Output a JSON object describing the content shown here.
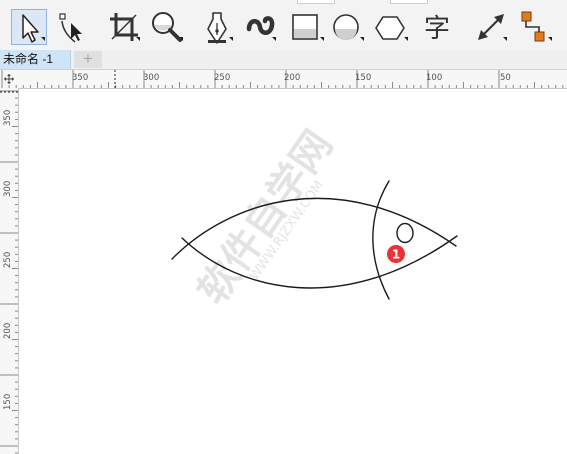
{
  "toolbar": {
    "tools": [
      {
        "name": "pick-tool",
        "icon": "arrow-pointer-icon",
        "selected": true
      },
      {
        "name": "shape-tool",
        "icon": "shape-edit-icon"
      },
      {
        "name": "crop-tool",
        "icon": "crop-icon"
      },
      {
        "name": "zoom-tool",
        "icon": "magnifier-icon"
      },
      {
        "name": "pen-tool",
        "icon": "pen-nib-icon"
      },
      {
        "name": "artistic-media-tool",
        "icon": "artistic-media-icon"
      },
      {
        "name": "rectangle-tool",
        "icon": "rectangle-icon"
      },
      {
        "name": "ellipse-tool",
        "icon": "ellipse-icon"
      },
      {
        "name": "polygon-tool",
        "icon": "hexagon-icon"
      },
      {
        "name": "text-tool",
        "icon": "text-icon",
        "label": "字"
      },
      {
        "name": "dimension-tool",
        "icon": "dimension-arrow-icon"
      },
      {
        "name": "connector-tool",
        "icon": "connector-icon"
      }
    ]
  },
  "tabs": {
    "document_title": "未命名 -1",
    "add_tab_symbol": "+"
  },
  "ruler": {
    "horizontal_labels": [
      "350",
      "300",
      "250",
      "200",
      "150",
      "100",
      "50"
    ],
    "vertical_labels": [
      "350",
      "300",
      "250",
      "200",
      "150"
    ]
  },
  "canvas": {
    "marker_number": "1",
    "watermark_main": "软件自学网",
    "watermark_sub": "WWW.RJZXW.COM"
  },
  "colors": {
    "marker": "#e8333a",
    "stroke": "#1a1a1a",
    "selection": "#dbe7f5",
    "accent_orange": "#e07b1f"
  }
}
